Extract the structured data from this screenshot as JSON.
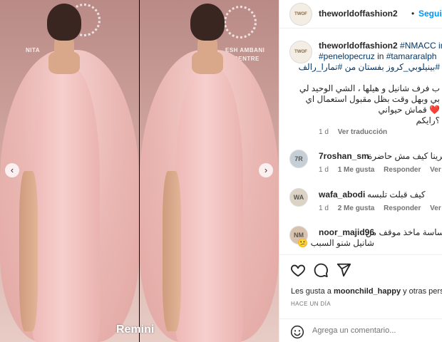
{
  "media": {
    "nav_prev_icon": "chevron-left-icon",
    "nav_next_icon": "chevron-right-icon",
    "left_logo_text": "NITA",
    "right_logo_text": "ESH AMBANI",
    "right_logo_text2": "CENTRE",
    "watermark": "Remini"
  },
  "header": {
    "avatar_text": "TWOF",
    "username": "theworldoffashion2",
    "dot": "•",
    "follow_label": "Seguir"
  },
  "caption": {
    "avatar_text": "TWOF",
    "username": "theworldoffashion2",
    "line1_tag": "#NMACC in #",
    "line2_tag_a": "#penelopecruz",
    "line2_in": " in ",
    "line2_tag_b": "#tamararalph",
    "line3": "#بينيلوبي_كروز بفستان من #تمارا_رالف",
    "line4": "ب فرف شانيل و هيلها ، الشي الوحيد لي",
    "line5": "بي وبهل وقت بظل مقبول استعمال اي",
    "line6": "❤️ قماش حيواني",
    "line7": "؟رايكم",
    "time": "1 d",
    "translate": "Ver traducción"
  },
  "comments": [
    {
      "username": "7roshan_sm",
      "text": "كاترينا كيف مش حاضرة",
      "time": "1 d",
      "likes": "1 Me gusta",
      "reply": "Responder",
      "more": "Ver tr",
      "avatar_text": "7R"
    },
    {
      "username": "wafa_abodi",
      "text": "كيف قبلت تلبسه",
      "time": "1 d",
      "likes": "2 Me gusta",
      "reply": "Responder",
      "more": "Ver tr",
      "avatar_text": "WA"
    },
    {
      "username": "noor_majid96",
      "text": "حساسة ماخذ موقف من",
      "text2": "شانيل شنو السبب 😕",
      "time": "",
      "likes": "",
      "reply": "",
      "more": "",
      "avatar_text": "NM"
    }
  ],
  "actions": {
    "like_icon": "heart-icon",
    "comment_icon": "comment-icon",
    "share_icon": "share-icon",
    "likes_prefix": "Les gusta a ",
    "likes_user": "moonchild_happy",
    "likes_suffix": " y otras pers",
    "time": "HACE UN DÍA"
  },
  "add_comment": {
    "emoji_icon": "emoji-smile-icon",
    "placeholder": "Agrega un comentario..."
  },
  "colors": {
    "accent": "#0095f6",
    "hashtag": "#00376b",
    "muted": "#737373"
  }
}
